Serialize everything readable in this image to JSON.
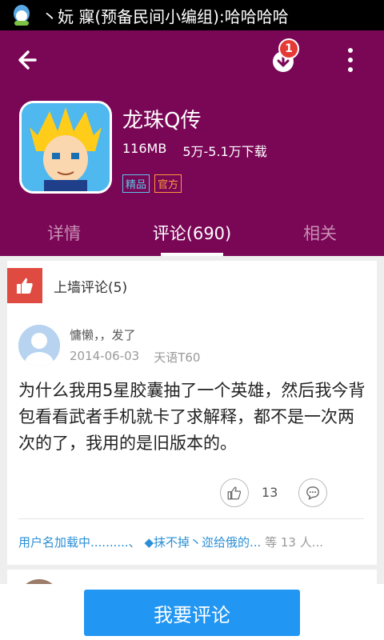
{
  "status_bar": {
    "notification_text": "丶妧 寱(预备民间小编组):哈哈哈哈",
    "icon": "qq-icon"
  },
  "header": {
    "back_icon": "back-arrow-icon",
    "download_icon": "download-icon",
    "download_badge": "1",
    "more_icon": "more-vert-icon",
    "bg_color": "#7a0656"
  },
  "app": {
    "name": "龙珠Q传",
    "size": "116MB",
    "downloads": "5万-5.1万下载",
    "tags": [
      "精品",
      "官方"
    ]
  },
  "tabs": [
    {
      "label": "详情",
      "active": false
    },
    {
      "label": "评论(690)",
      "active": true
    },
    {
      "label": "相关",
      "active": false
    }
  ],
  "section": {
    "icon": "thumbs-up-icon",
    "title": "上墙评论(5)"
  },
  "comment": {
    "user": "慵懒，，发了",
    "date": "2014-06-03",
    "device": "天语T60",
    "text": "为什么我用5星胶囊抽了一个英雄，然后我今背包看看武者手机就卡了求解释，都不是一次两次的了，我用的是旧版本的。",
    "like_count": "13",
    "like_icon": "thumbs-up-outline-icon",
    "reply_icon": "comment-bubble-icon"
  },
  "likers": {
    "names": "用户名加载中..........、 ◆抹不掉丶迩给俄的...",
    "suffix": "等 13 人..."
  },
  "bottom": {
    "button_label": "我要评论",
    "button_color": "#2196f3"
  }
}
